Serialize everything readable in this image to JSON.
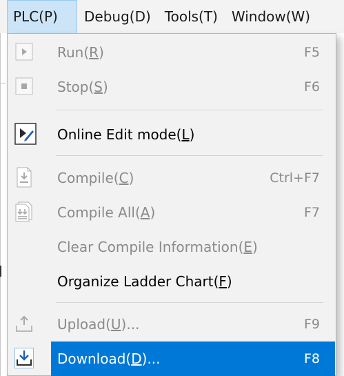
{
  "menubar": {
    "plc": "PLC(P)",
    "debug": "Debug(D)",
    "tools": "Tools(T)",
    "window": "Window(W)"
  },
  "menu": {
    "items": [
      {
        "id": "run",
        "pre": "Run(",
        "mnemonic": "R",
        "post": ")",
        "shortcut": "F5",
        "icon": "play-icon",
        "enabled": false
      },
      {
        "id": "stop",
        "pre": "Stop(",
        "mnemonic": "S",
        "post": ")",
        "shortcut": "F6",
        "icon": "stop-icon",
        "enabled": false
      },
      {
        "id": "online-edit",
        "pre": "Online Edit mode(",
        "mnemonic": "L",
        "post": ")",
        "shortcut": "",
        "icon": "online-edit-icon",
        "enabled": true
      },
      {
        "id": "compile",
        "pre": "Compile(",
        "mnemonic": "C",
        "post": ")",
        "shortcut": "Ctrl+F7",
        "icon": "compile-icon",
        "enabled": false
      },
      {
        "id": "compile-all",
        "pre": "Compile All(",
        "mnemonic": "A",
        "post": ")",
        "shortcut": "F7",
        "icon": "compile-all-icon",
        "enabled": false
      },
      {
        "id": "clear-compile",
        "pre": "Clear Compile Information(",
        "mnemonic": "E",
        "post": ")",
        "shortcut": "",
        "icon": "",
        "enabled": false
      },
      {
        "id": "organize",
        "pre": "Organize Ladder Chart(",
        "mnemonic": "F",
        "post": ")",
        "shortcut": "",
        "icon": "",
        "enabled": true
      },
      {
        "id": "upload",
        "pre": "Upload(",
        "mnemonic": "U",
        "post": ")...",
        "shortcut": "F9",
        "icon": "upload-icon",
        "enabled": false
      },
      {
        "id": "download",
        "pre": "Download(",
        "mnemonic": "D",
        "post": ")...",
        "shortcut": "F8",
        "icon": "download-icon",
        "enabled": true,
        "highlighted": true
      }
    ]
  },
  "colors": {
    "highlight": "#0078d7",
    "menubar_active": "#cce4f7",
    "menu_bg": "#f2f2f2",
    "disabled_text": "#8a8a8a"
  }
}
